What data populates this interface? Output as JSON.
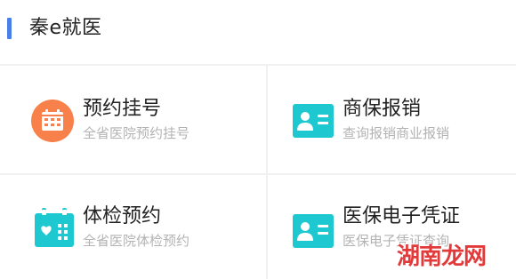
{
  "header": {
    "title": "秦e就医"
  },
  "tiles": [
    {
      "title": "预约挂号",
      "subtitle": "全省医院预约挂号",
      "icon": "calendar-icon",
      "icon_color": "#f8814b"
    },
    {
      "title": "商保报销",
      "subtitle": "查询报销商业报销",
      "icon": "id-card-icon",
      "icon_color": "#1ec8d0"
    },
    {
      "title": "体检预约",
      "subtitle": "全省医院体检预约",
      "icon": "health-calendar-icon",
      "icon_color": "#1ec8d0"
    },
    {
      "title": "医保电子凭证",
      "subtitle": "医保电子凭证查询",
      "icon": "id-card-icon",
      "icon_color": "#1ec8d0"
    }
  ],
  "watermark": "湖南龙网",
  "colors": {
    "accent": "#4a7fe8",
    "divider": "#f1f1f1",
    "subtitle": "#b3b3b3"
  }
}
